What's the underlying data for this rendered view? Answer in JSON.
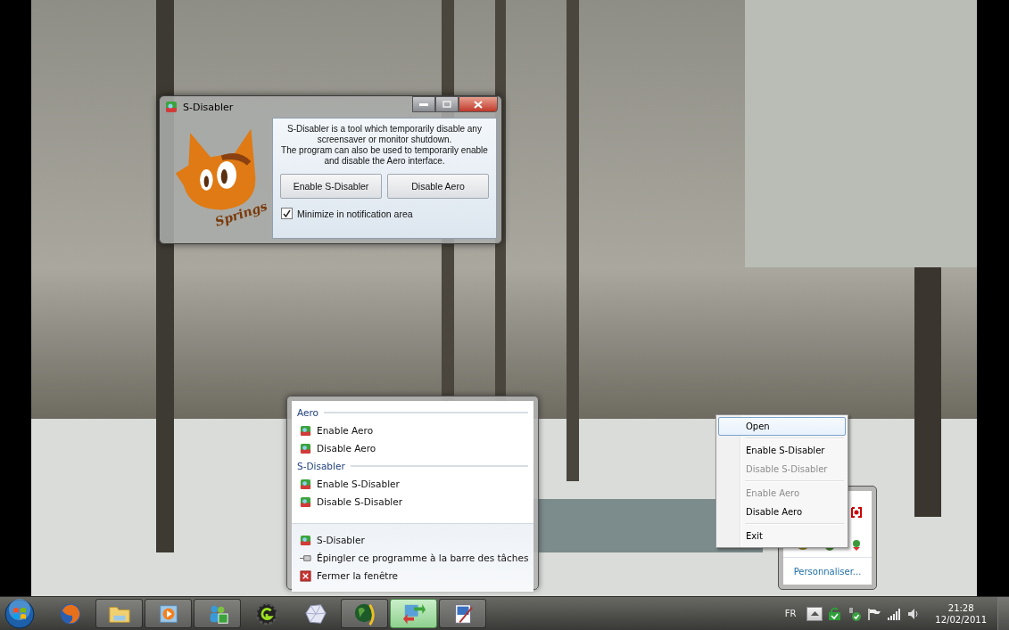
{
  "dialog": {
    "title": "S-Disabler",
    "logo_text": "Springs",
    "description": [
      "S-Disabler is a tool which temporarily disable any",
      "screensaver or monitor shutdown.",
      "The program can also be used to temporarily enable",
      "and disable the Aero interface."
    ],
    "buttons": [
      "Enable S-Disabler",
      "Disable Aero"
    ],
    "checkbox": {
      "label": "Minimize in notification area",
      "checked": true
    }
  },
  "jump_list": {
    "sections": [
      {
        "title": "Aero",
        "items": [
          "Enable Aero",
          "Disable Aero"
        ]
      },
      {
        "title": "S-Disabler",
        "items": [
          "Enable S-Disabler",
          "Disable S-Disabler"
        ]
      }
    ],
    "tasks": [
      {
        "kind": "app",
        "label": "S-Disabler"
      },
      {
        "kind": "pin",
        "label": "Épingler ce programme à la barre des tâches"
      },
      {
        "kind": "close",
        "label": "Fermer la fenêtre"
      }
    ]
  },
  "context_menu": [
    {
      "kind": "item",
      "label": "Open",
      "selected": true,
      "disabled": false
    },
    {
      "kind": "separator"
    },
    {
      "kind": "item",
      "label": "Enable S-Disabler",
      "selected": false,
      "disabled": false
    },
    {
      "kind": "item",
      "label": "Disable S-Disabler",
      "selected": false,
      "disabled": true
    },
    {
      "kind": "separator"
    },
    {
      "kind": "item",
      "label": "Enable Aero",
      "selected": false,
      "disabled": true
    },
    {
      "kind": "item",
      "label": "Disable Aero",
      "selected": false,
      "disabled": false
    },
    {
      "kind": "separator"
    },
    {
      "kind": "item",
      "label": "Exit",
      "selected": false,
      "disabled": false
    }
  ],
  "tray_overflow": {
    "link": "Personnaliser..."
  },
  "taskbar": {
    "buttons": [
      {
        "kind": "firefox",
        "running": false,
        "selected": false
      },
      {
        "kind": "folder",
        "running": true,
        "selected": false
      },
      {
        "kind": "media",
        "running": true,
        "selected": false
      },
      {
        "kind": "messenger",
        "running": true,
        "selected": false
      },
      {
        "kind": "gear",
        "running": false,
        "selected": false
      },
      {
        "kind": "crystal",
        "running": false,
        "selected": false
      },
      {
        "kind": "globe",
        "running": true,
        "selected": false
      },
      {
        "kind": "app",
        "running": true,
        "selected": true
      },
      {
        "kind": "paint",
        "running": true,
        "selected": false
      }
    ],
    "language": "FR",
    "time": "21:28",
    "date": "12/02/2011"
  }
}
